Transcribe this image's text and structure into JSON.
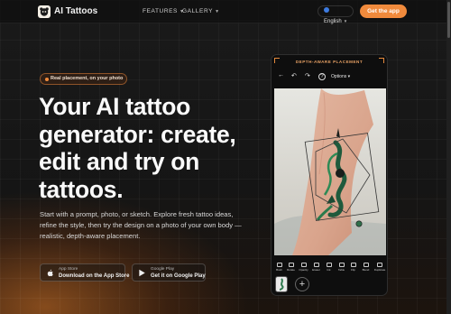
{
  "nav": {
    "brand": "AI Tattoos",
    "features_label": "FEATURES",
    "gallery_label": "GALLERY",
    "language": "English",
    "get_app_label": "Get the app"
  },
  "hero": {
    "badge": "Real placement, on your photo",
    "headline": "Your AI tattoo generator: create, edit and try on tattoos.",
    "description": "Start with a prompt, photo, or sketch. Explore fresh tattoo ideas, refine the style, then try the design on a photo of your own body — realistic, depth-aware placement.",
    "app_store": {
      "small": "App Store",
      "big": "Download on the App Store"
    },
    "google_play": {
      "small": "Google Play",
      "big": "Get it on Google Play"
    }
  },
  "phone": {
    "tag": "DEPTH-AWARE PLACEMENT",
    "options_label": "Options",
    "tools": [
      "Bush",
      "Rotate",
      "Opacity",
      "Eraser",
      "Ink",
      "Table",
      "Flip",
      "Blend",
      "Duplicate"
    ],
    "add_label": "+"
  },
  "colors": {
    "accent": "#f08a3c",
    "background": "#141414"
  }
}
